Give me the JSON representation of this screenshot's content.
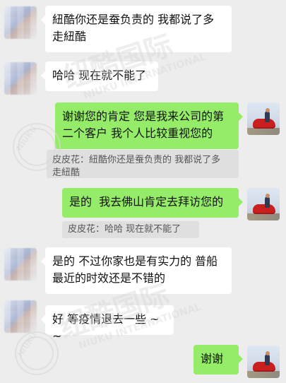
{
  "messages": [
    {
      "id": 1,
      "side": "incoming",
      "text": "紐酷你还是蚕负责的 我都说了多\n走紐酷"
    },
    {
      "id": 2,
      "side": "incoming",
      "text": "哈哈 现在就不能了"
    },
    {
      "id": 3,
      "side": "outgoing",
      "text": "谢谢您的肯定 您是我来公司的第\n二个客户 我个人比较重视您的",
      "quote": "皮皮花：紐酷你还是蚕负责的 我都说了多\n走紐酷"
    },
    {
      "id": 4,
      "side": "outgoing",
      "text": "是的  我去佛山肯定去拜访您的",
      "quote": "皮皮花：哈哈 现在就不能了"
    },
    {
      "id": 5,
      "side": "incoming",
      "text": "是的 不过你家也是有实力的 普船\n最近的时效还是不错的"
    },
    {
      "id": 6,
      "side": "incoming",
      "text": "好 等疫情退去一些 ~~"
    },
    {
      "id": 7,
      "side": "outgoing",
      "text": "谢谢"
    }
  ],
  "watermark": {
    "text_cn": "纽酷国际",
    "text_en": "NIUKU INTERNATIONAL",
    "circle_text": "NIUKU"
  },
  "colors": {
    "background": "#ededed",
    "incoming_bubble": "#ffffff",
    "outgoing_bubble": "#95ec69",
    "quote_background": "#dfdfdf"
  },
  "icons": {
    "incoming_avatar": "blurred-contact-avatar-icon",
    "outgoing_avatar": "red-car-photo-avatar-icon"
  }
}
